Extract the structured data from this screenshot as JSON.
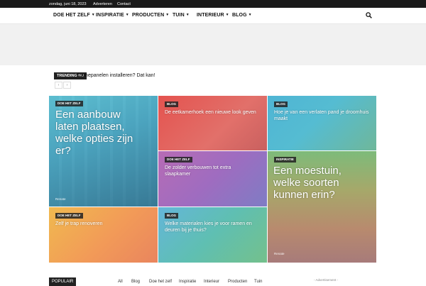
{
  "topbar": {
    "date": "zondag, juni 18, 2023",
    "link1": "Adverteren",
    "link2": "Contact"
  },
  "nav": {
    "items": [
      "DOE HET ZELF",
      "INSPIRATIE",
      "PRODUCTEN",
      "TUIN",
      "INTERIEUR",
      "BLOG"
    ]
  },
  "ticker": {
    "label": "TRENDING NU",
    "text": "Zonnepanelen installeren? Dat kan!",
    "prev": "‹",
    "next": "›"
  },
  "tiles": [
    {
      "category": "Doe het zelf",
      "title": "Een aanbouw laten plaatsen, welke opties zijn er?",
      "author": "Renate"
    },
    {
      "category": "Blog",
      "title": "De eetkamerhoek een nieuwe look geven"
    },
    {
      "category": "Blog",
      "title": "Hoe je van een verlaten pand je droomhuis maakt"
    },
    {
      "category": "Doe het zelf",
      "title": "De zolder verbouwen tot extra slaapkamer"
    },
    {
      "category": "Inspiratie",
      "title": "Een moestuin, welke soorten kunnen erin?",
      "author": "Renate"
    },
    {
      "category": "Doe het zelf",
      "title": "Zelf je trap renoveren"
    },
    {
      "category": "Blog",
      "title": "Welke materialen kies je voor ramen en deuren bij je thuis?"
    }
  ],
  "bottom": {
    "populair": "POPULAIR",
    "tabs": [
      "All",
      "Blog",
      "Doe het zelf",
      "Inspiratie",
      "Interieur",
      "Producten",
      "Tuin"
    ],
    "advertisement": "- Advertisement -"
  },
  "colors": {
    "topbar": "#1a1a1a",
    "accent": "#222222"
  }
}
